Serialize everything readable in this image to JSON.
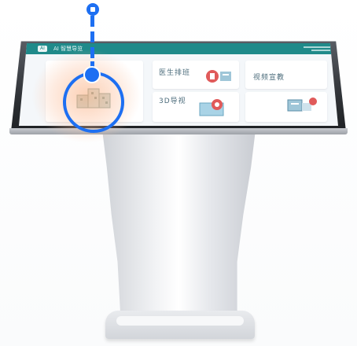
{
  "screen": {
    "header": {
      "logo_badge": "AI",
      "app_title": "AI 智慧导览"
    },
    "tiles": [
      {
        "label": "",
        "icon": "building-model-icon"
      },
      {
        "label": "医生排班",
        "icon": "doctor-schedule-icon"
      },
      {
        "label": "视频宣教",
        "icon": "video-education-icon"
      },
      {
        "label": "3D导视",
        "icon": "3d-navigation-icon"
      },
      {
        "label": "",
        "icon": "blank-tile"
      }
    ]
  },
  "colors": {
    "header": "#1f8a8a",
    "marker": "#1d6ff2",
    "highlight": "#f7a97b"
  }
}
